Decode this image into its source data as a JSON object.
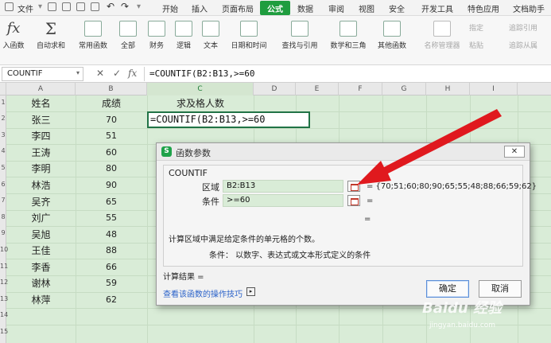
{
  "menu": {
    "file": "文件",
    "tabs": [
      "开始",
      "插入",
      "页面布局",
      "公式",
      "数据",
      "审阅",
      "视图",
      "安全",
      "开发工具",
      "特色应用",
      "文档助手"
    ],
    "active_tab": "公式"
  },
  "ribbon": {
    "insert_function": "入函数",
    "autosum": "自动求和",
    "common": "常用函数",
    "all": "全部",
    "finance": "财务",
    "logic": "逻辑",
    "text": "文本",
    "datetime": "日期和时间",
    "lookup": "查找与引用",
    "math": "数学和三角",
    "other": "其他函数",
    "name_manager": "名称管理器",
    "specify": "指定",
    "paste": "粘贴",
    "trace_precedents": "追踪引用",
    "trace_dependents": "追踪从属"
  },
  "formula_bar": {
    "name_box": "COUNTIF",
    "formula": "=COUNTIF(B2:B13,>=60"
  },
  "columns": [
    "A",
    "B",
    "C",
    "D",
    "E",
    "F",
    "G",
    "H",
    "I"
  ],
  "row_numbers": [
    "1",
    "2",
    "3",
    "4",
    "5",
    "6",
    "7",
    "8",
    "9",
    "10",
    "11",
    "12",
    "13",
    "14",
    "15"
  ],
  "sheet": {
    "header": {
      "name": "姓名",
      "score": "成绩",
      "task": "求及格人数"
    },
    "rows": [
      {
        "name": "张三",
        "score": "70"
      },
      {
        "name": "李四",
        "score": "51"
      },
      {
        "name": "王涛",
        "score": "60"
      },
      {
        "name": "李明",
        "score": "80"
      },
      {
        "name": "林浩",
        "score": "90"
      },
      {
        "name": "吴齐",
        "score": "65"
      },
      {
        "name": "刘广",
        "score": "55"
      },
      {
        "name": "吴旭",
        "score": "48"
      },
      {
        "name": "王佳",
        "score": "88"
      },
      {
        "name": "李香",
        "score": "66"
      },
      {
        "name": "谢林",
        "score": "59"
      },
      {
        "name": "林萍",
        "score": "62"
      }
    ],
    "active_cell_text": "=COUNTIF(B2:B13,>=60"
  },
  "dialog": {
    "title": "函数参数",
    "close": "✕",
    "function_name": "COUNTIF",
    "args": [
      {
        "label": "区域",
        "value": "B2:B13",
        "result": "= {70;51;60;80;90;65;55;48;88;66;59;62}"
      },
      {
        "label": "条件",
        "value": ">=60",
        "result": "="
      }
    ],
    "overall_eq": "=",
    "description": "计算区域中满足给定条件的单元格的个数。",
    "arg_description": "条件：  以数字、表达式或文本形式定义的条件",
    "calc_result": "计算结果 =",
    "help_link": "查看该函数的操作技巧",
    "ok": "确定",
    "cancel": "取消"
  },
  "watermark": {
    "brand": "Baidu 经验",
    "url": "jingyan.baidu.com"
  },
  "colors": {
    "accent": "#1f9d3f",
    "sheet_bg": "#d9ecd7",
    "arrow": "#e0191e",
    "link": "#2a62c9"
  }
}
